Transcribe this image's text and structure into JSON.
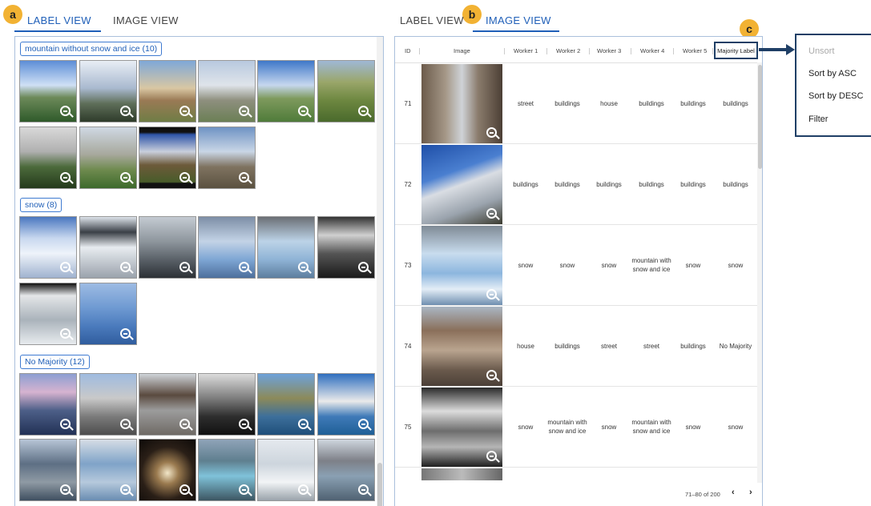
{
  "badges": {
    "a": "a",
    "b": "b",
    "c": "c"
  },
  "left_tabs": {
    "label_view": "LABEL VIEW",
    "image_view": "IMAGE VIEW"
  },
  "right_tabs": {
    "label_view": "LABEL VIEW",
    "image_view": "IMAGE VIEW"
  },
  "groups": [
    {
      "title": "mountain without snow and ice (10)"
    },
    {
      "title": "snow (8)"
    },
    {
      "title": "No Majority (12)"
    }
  ],
  "table": {
    "headers": [
      "ID",
      "Image",
      "Worker 1",
      "Worker 2",
      "Worker 3",
      "Worker 4",
      "Worker 5",
      "Majority Label"
    ],
    "rows": [
      {
        "id": "71",
        "w1": "street",
        "w2": "buildings",
        "w3": "house",
        "w4": "buildings",
        "w5": "buildings",
        "majority": "buildings"
      },
      {
        "id": "72",
        "w1": "buildings",
        "w2": "buildings",
        "w3": "buildings",
        "w4": "buildings",
        "w5": "buildings",
        "majority": "buildings"
      },
      {
        "id": "73",
        "w1": "snow",
        "w2": "snow",
        "w3": "snow",
        "w4": "mountain with snow and ice",
        "w5": "snow",
        "majority": "snow"
      },
      {
        "id": "74",
        "w1": "house",
        "w2": "buildings",
        "w3": "street",
        "w4": "street",
        "w5": "buildings",
        "majority": "No Majority"
      },
      {
        "id": "75",
        "w1": "snow",
        "w2": "mountain with snow and ice",
        "w3": "snow",
        "w4": "mountain with snow and ice",
        "w5": "snow",
        "majority": "snow"
      }
    ],
    "pagination": "71–80 of 200",
    "prev_icon": "‹",
    "next_icon": "›"
  },
  "sort_menu": {
    "items": [
      "Unsort",
      "Sort by ASC",
      "Sort by DESC",
      "Filter"
    ]
  },
  "colors": {
    "accent": "#1f5fb8",
    "badge": "#f2b233",
    "menu_border": "#1f3f66"
  }
}
